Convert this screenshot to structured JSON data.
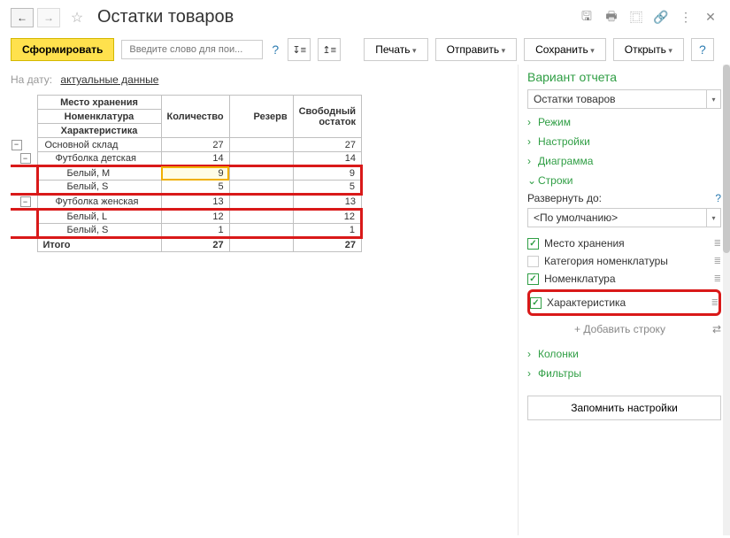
{
  "header": {
    "title": "Остатки товаров"
  },
  "toolbar": {
    "generate": "Сформировать",
    "search_placeholder": "Введите слово для пои...",
    "print": "Печать",
    "send": "Отправить",
    "save": "Сохранить",
    "open": "Открыть"
  },
  "date_line": {
    "label": "На дату:",
    "value": "актуальные данные"
  },
  "report": {
    "headers": {
      "col1a": "Место хранения",
      "col1b": "Номенклатура",
      "col1c": "Характеристика",
      "qty": "Количество",
      "reserve": "Резерв",
      "free": "Свободный остаток"
    },
    "rows": [
      {
        "name": "Основной склад",
        "ind": 0,
        "qty": "27",
        "free": "27",
        "tree": "−"
      },
      {
        "name": "Футболка детская",
        "ind": 1,
        "qty": "14",
        "free": "14",
        "tree": "−"
      },
      {
        "name": "Белый, M",
        "ind": 2,
        "qty": "9",
        "free": "9",
        "hl": true,
        "red": "top"
      },
      {
        "name": "Белый, S",
        "ind": 2,
        "qty": "5",
        "free": "5",
        "red": "bottom"
      },
      {
        "name": "Футболка женская",
        "ind": 1,
        "qty": "13",
        "free": "13",
        "tree": "−"
      },
      {
        "name": "Белый, L",
        "ind": 2,
        "qty": "12",
        "free": "12",
        "red": "top"
      },
      {
        "name": "Белый, S",
        "ind": 2,
        "qty": "1",
        "free": "1",
        "red": "bottom"
      }
    ],
    "total": {
      "label": "Итого",
      "qty": "27",
      "free": "27"
    }
  },
  "panel": {
    "title": "Вариант отчета",
    "variant": "Остатки товаров",
    "sections": {
      "mode": "Режим",
      "settings": "Настройки",
      "chart": "Диаграмма",
      "rows": "Строки",
      "cols": "Колонки",
      "filters": "Фильтры"
    },
    "rows_section": {
      "expand_label": "Развернуть до:",
      "default_opt": "<По умолчанию>",
      "checks": [
        {
          "label": "Место хранения",
          "on": true
        },
        {
          "label": "Категория номенклатуры",
          "on": false
        },
        {
          "label": "Номенклатура",
          "on": true
        },
        {
          "label": "Характеристика",
          "on": true,
          "red": true
        }
      ],
      "add": "+ Добавить строку"
    },
    "memo": "Запомнить настройки"
  }
}
